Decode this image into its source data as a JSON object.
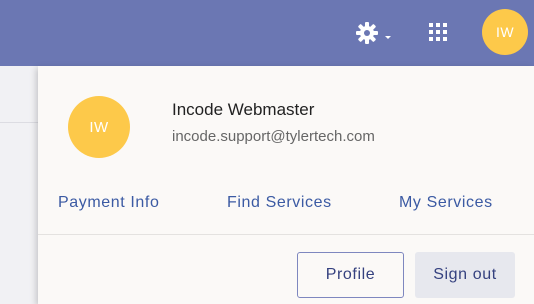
{
  "header": {
    "avatar_initials": "IW",
    "settings_icon": "gear-icon",
    "apps_icon": "grid-icon",
    "bar_color": "#6b77b3"
  },
  "account_menu": {
    "avatar_initials": "IW",
    "avatar_color": "#fdc94a",
    "name": "Incode Webmaster",
    "email": "incode.support@tylertech.com",
    "links": [
      "Payment Info",
      "Find Services",
      "My Services"
    ],
    "profile_label": "Profile",
    "signout_label": "Sign out",
    "accent_color": "#3b5aa3"
  }
}
